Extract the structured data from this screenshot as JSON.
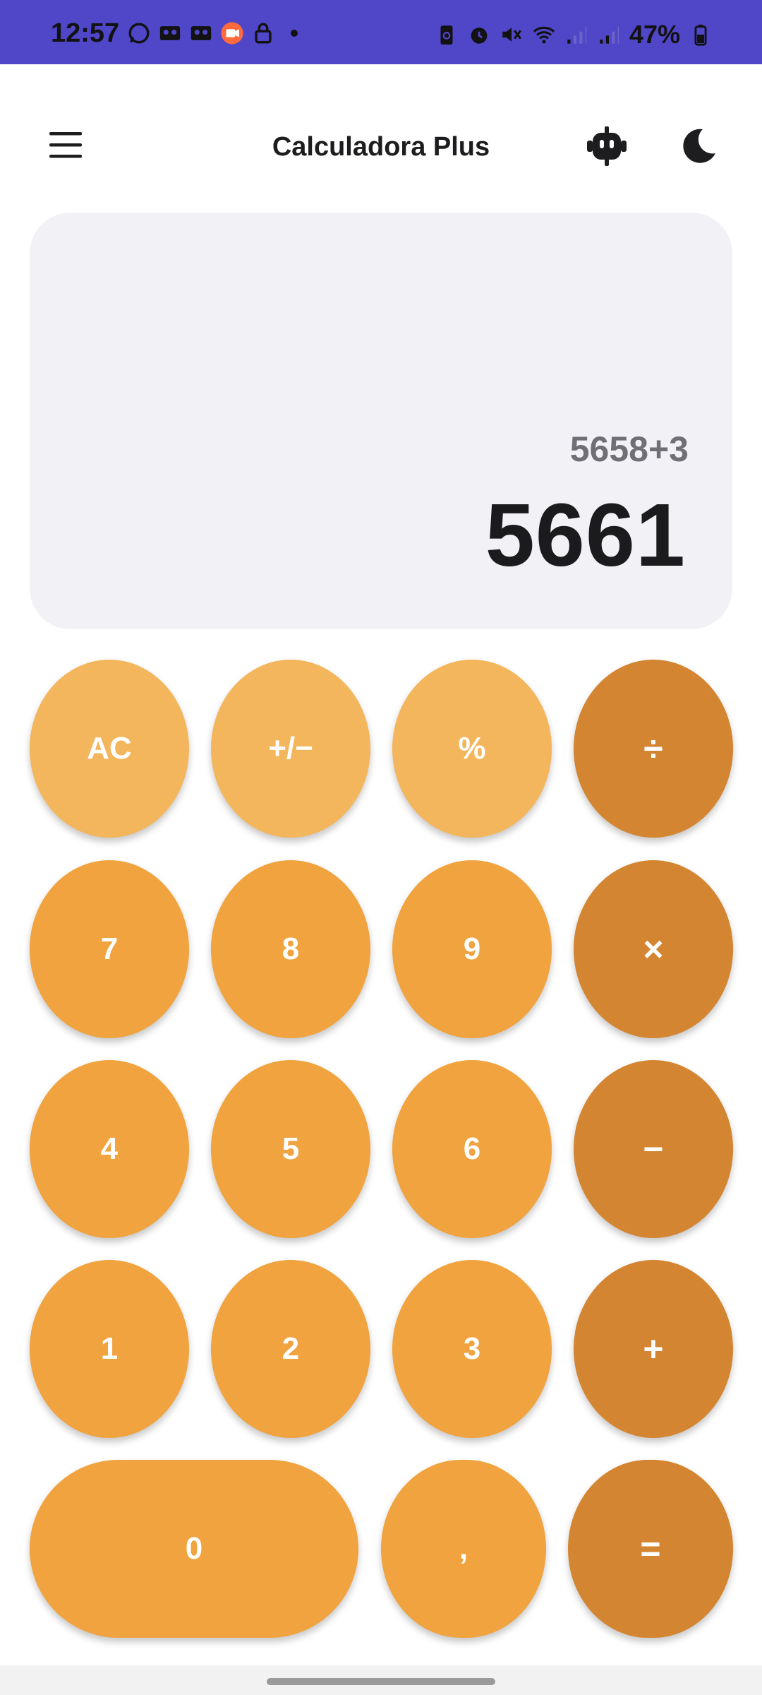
{
  "status_bar": {
    "time": "12:57",
    "battery_percent": "47%",
    "left_icons": [
      "whatsapp-icon",
      "voicemail-icon",
      "voicemail-icon",
      "screen-recorder-icon",
      "lock-icon",
      "dot-icon"
    ],
    "right_icons": [
      "battery-saver-icon",
      "alarm-icon",
      "mute-icon",
      "wifi-icon",
      "signal-icon",
      "signal-icon",
      "battery-icon"
    ],
    "background": "#4f46c8"
  },
  "app_bar": {
    "title": "Calculadora Plus",
    "menu_icon": "menu-icon",
    "bot_icon": "robot-icon",
    "theme_icon": "moon-icon"
  },
  "display": {
    "expression": "5658+3",
    "result": "5661"
  },
  "keypad": {
    "row1": [
      "AC",
      "+/−",
      "%",
      "÷"
    ],
    "row2": [
      "7",
      "8",
      "9",
      "×"
    ],
    "row3": [
      "4",
      "5",
      "6",
      "−"
    ],
    "row4": [
      "1",
      "2",
      "3",
      "+"
    ],
    "row5": [
      "0",
      ",",
      "="
    ]
  },
  "colors": {
    "function_key": "#f3b65c",
    "number_key": "#f0a33e",
    "operator_key": "#d48531",
    "display_bg": "#f2f2f6"
  }
}
